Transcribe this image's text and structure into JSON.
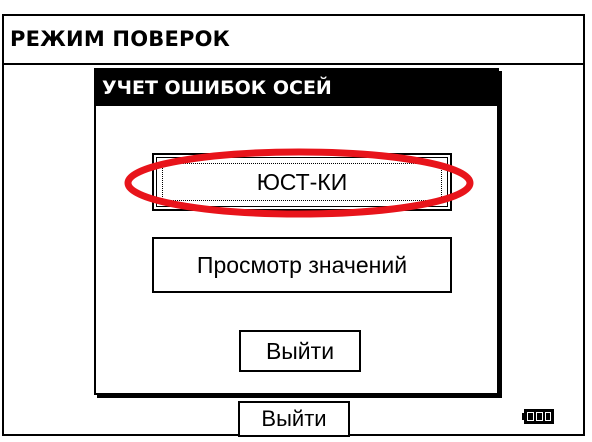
{
  "main": {
    "title": "РЕЖИМ ПОВЕРОК",
    "exit_label": "Выйти",
    "battery_icon": "battery-icon"
  },
  "dialog": {
    "title": "УЧЕТ ОШИБОК ОСЕЙ",
    "buttons": [
      {
        "label": "ЮСТ-КИ",
        "focused": true
      },
      {
        "label": "Просмотр значений"
      },
      {
        "label": "Выйти"
      }
    ]
  },
  "annotation": {
    "highlight_color": "#e8141b"
  }
}
